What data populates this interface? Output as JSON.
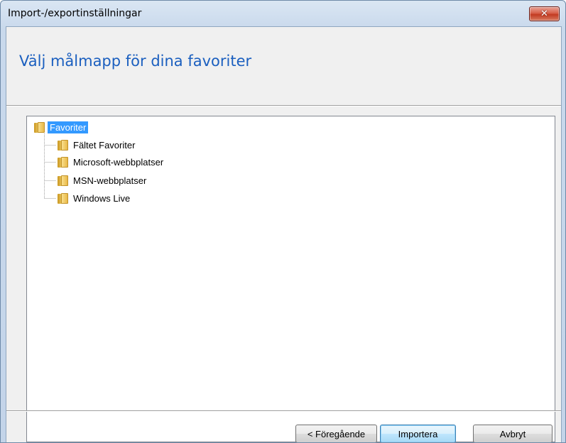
{
  "window": {
    "title": "Import-/exportinställningar",
    "close_icon_glyph": "✕"
  },
  "header": {
    "heading": "Välj målmapp för dina favoriter"
  },
  "tree": {
    "root": {
      "label": "Favoriter",
      "selected": true,
      "icon": "folder-icon"
    },
    "children": [
      {
        "label": "Fältet Favoriter",
        "icon": "folder-icon"
      },
      {
        "label": "Microsoft-webbplatser",
        "icon": "folder-icon"
      },
      {
        "label": "MSN-webbplatser",
        "icon": "folder-icon"
      },
      {
        "label": "Windows Live",
        "icon": "folder-icon"
      }
    ]
  },
  "buttons": {
    "back_label": "< Föregående",
    "import_label": "Importera",
    "cancel_label": "Avbryt"
  },
  "colors": {
    "heading": "#1b5fbf",
    "selection": "#3399ff",
    "close_button": "#c23b22"
  }
}
